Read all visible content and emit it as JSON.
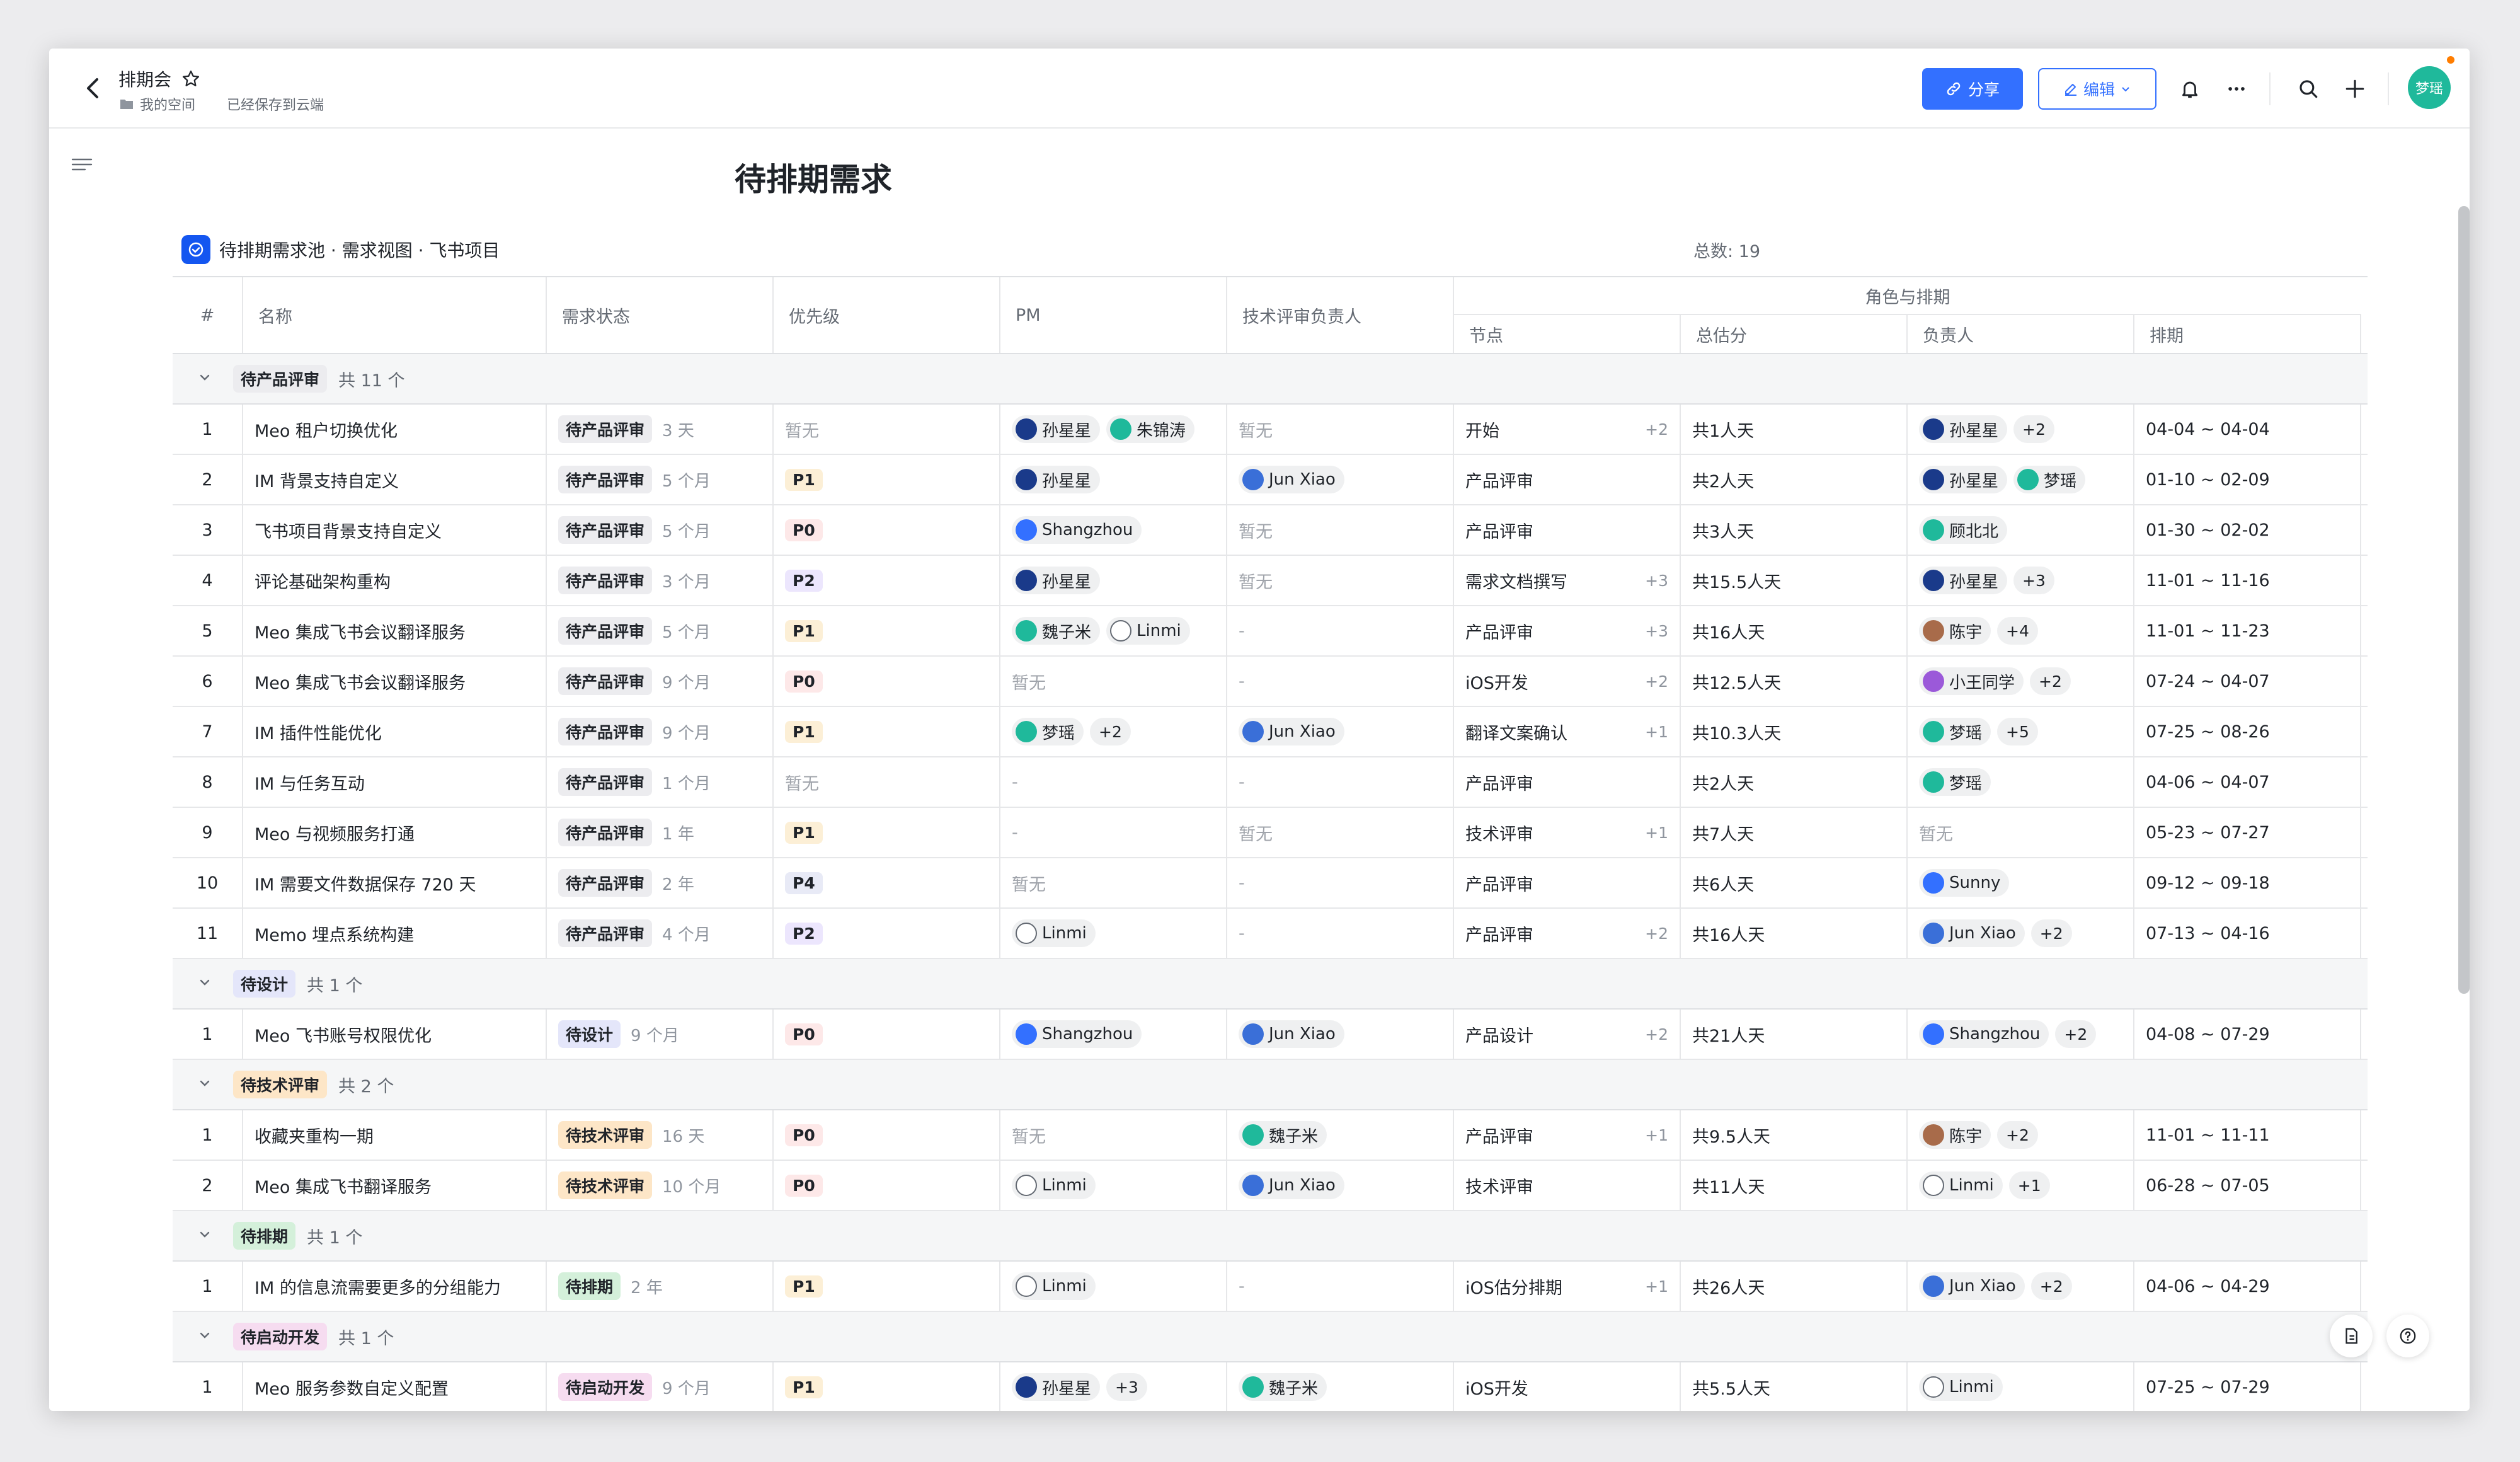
{
  "app": {
    "doc_title": "排期会",
    "crumb_space": "我的空间",
    "saved_status": "已经保存到云端",
    "share_label": "分享",
    "edit_label": "编辑",
    "user_initials": "梦瑶"
  },
  "page_title": "待排期需求",
  "source": {
    "label": "待排期需求池 · 需求视图 · 飞书项目",
    "total": "总数: 19"
  },
  "headers": {
    "num": "#",
    "name": "名称",
    "status": "需求状态",
    "priority": "优先级",
    "pm": "PM",
    "tech": "技术评审负责人",
    "group": "角色与排期",
    "node": "节点",
    "estimate": "总估分",
    "owner": "负责人",
    "schedule": "排期"
  },
  "colors": {
    "accent": "#3370ff",
    "avatar_teal": "#1fb99b",
    "notify": "#ff7d00"
  },
  "groups": [
    {
      "tag": "待产品评审",
      "count": "共 11 个",
      "style": "t-prod",
      "rows": [
        {
          "n": "1",
          "name": "Meo 租户切换优化",
          "status": "待产品评审",
          "age": "3 天",
          "pri": "暂无",
          "pm": [
            {
              "name": "孙星星",
              "c": "#1a3a8a"
            },
            {
              "name": "朱锦涛",
              "c": "#1fb99b"
            }
          ],
          "pm_more": "",
          "tech": [],
          "tech_text": "暂无",
          "node": "开始",
          "node_more": "+2",
          "est": "共1人天",
          "owner": [
            {
              "name": "孙星星",
              "c": "#1a3a8a"
            }
          ],
          "owner_more": "+2",
          "sched": "04-04 ~ 04-04"
        },
        {
          "n": "2",
          "name": "IM 背景支持自定义",
          "status": "待产品评审",
          "age": "5 个月",
          "pri": "P1",
          "pm": [
            {
              "name": "孙星星",
              "c": "#1a3a8a"
            }
          ],
          "pm_more": "",
          "tech": [
            {
              "name": "Jun Xiao",
              "c": "#3a6fd8"
            }
          ],
          "tech_text": "",
          "node": "产品评审",
          "node_more": "",
          "est": "共2人天",
          "owner": [
            {
              "name": "孙星星",
              "c": "#1a3a8a"
            },
            {
              "name": "梦瑶",
              "c": "#1fb99b"
            }
          ],
          "owner_more": "",
          "sched": "01-10 ~ 02-09"
        },
        {
          "n": "3",
          "name": "飞书项目背景支持自定义",
          "status": "待产品评审",
          "age": "5 个月",
          "pri": "P0",
          "pm": [
            {
              "name": "Shangzhou",
              "c": "#3370ff"
            }
          ],
          "pm_more": "",
          "tech": [],
          "tech_text": "暂无",
          "node": "产品评审",
          "node_more": "",
          "est": "共3人天",
          "owner": [
            {
              "name": "顾北北",
              "c": "#1fb99b"
            }
          ],
          "owner_more": "",
          "sched": "01-30 ~ 02-02"
        },
        {
          "n": "4",
          "name": "评论基础架构重构",
          "status": "待产品评审",
          "age": "3 个月",
          "pri": "P2",
          "pm": [
            {
              "name": "孙星星",
              "c": "#1a3a8a"
            }
          ],
          "pm_more": "",
          "tech": [],
          "tech_text": "暂无",
          "node": "需求文档撰写",
          "node_more": "+3",
          "est": "共15.5人天",
          "owner": [
            {
              "name": "孙星星",
              "c": "#1a3a8a"
            }
          ],
          "owner_more": "+3",
          "sched": "11-01 ~ 11-16"
        },
        {
          "n": "5",
          "name": "Meo 集成飞书会议翻译服务",
          "status": "待产品评审",
          "age": "5 个月",
          "pri": "P1",
          "pm": [
            {
              "name": "魏子米",
              "c": "#1fb99b"
            },
            {
              "name": "Linmi",
              "c": "#ffffff"
            }
          ],
          "pm_more": "",
          "tech": [],
          "tech_text": "-",
          "node": "产品评审",
          "node_more": "+3",
          "est": "共16人天",
          "owner": [
            {
              "name": "陈宇",
              "c": "#a86b4a"
            }
          ],
          "owner_more": "+4",
          "sched": "11-01 ~ 11-23"
        },
        {
          "n": "6",
          "name": "Meo 集成飞书会议翻译服务",
          "status": "待产品评审",
          "age": "9 个月",
          "pri": "P0",
          "pm": [],
          "pm_text": "暂无",
          "pm_more": "",
          "tech": [],
          "tech_text": "-",
          "node": "iOS开发",
          "node_more": "+2",
          "est": "共12.5人天",
          "owner": [
            {
              "name": "小王同学",
              "c": "#9b59d9"
            }
          ],
          "owner_more": "+2",
          "sched": "07-24 ~ 04-07"
        },
        {
          "n": "7",
          "name": "IM 插件性能优化",
          "status": "待产品评审",
          "age": "9 个月",
          "pri": "P1",
          "pm": [
            {
              "name": "梦瑶",
              "c": "#1fb99b"
            }
          ],
          "pm_more": "+2",
          "tech": [
            {
              "name": "Jun Xiao",
              "c": "#3a6fd8"
            }
          ],
          "tech_text": "",
          "node": "翻译文案确认",
          "node_more": "+1",
          "est": "共10.3人天",
          "owner": [
            {
              "name": "梦瑶",
              "c": "#1fb99b"
            }
          ],
          "owner_more": "+5",
          "sched": "07-25 ~ 08-26"
        },
        {
          "n": "8",
          "name": "IM 与任务互动",
          "status": "待产品评审",
          "age": "1 个月",
          "pri": "暂无",
          "pm": [],
          "pm_text": "-",
          "pm_more": "",
          "tech": [],
          "tech_text": "-",
          "node": "产品评审",
          "node_more": "",
          "est": "共2人天",
          "owner": [
            {
              "name": "梦瑶",
              "c": "#1fb99b"
            }
          ],
          "owner_more": "",
          "sched": "04-06 ~ 04-07"
        },
        {
          "n": "9",
          "name": "Meo 与视频服务打通",
          "status": "待产品评审",
          "age": "1 年",
          "pri": "P1",
          "pm": [],
          "pm_text": "-",
          "pm_more": "",
          "tech": [],
          "tech_text": "暂无",
          "node": "技术评审",
          "node_more": "+1",
          "est": "共7人天",
          "owner": [],
          "owner_text": "暂无",
          "owner_more": "",
          "sched": "05-23 ~ 07-27"
        },
        {
          "n": "10",
          "name": "IM 需要文件数据保存 720 天",
          "status": "待产品评审",
          "age": "2 年",
          "pri": "P4",
          "pm": [],
          "pm_text": "暂无",
          "pm_more": "",
          "tech": [],
          "tech_text": "-",
          "node": "产品评审",
          "node_more": "",
          "est": "共6人天",
          "owner": [
            {
              "name": "Sunny",
              "c": "#3370ff"
            }
          ],
          "owner_more": "",
          "sched": "09-12 ~ 09-18"
        },
        {
          "n": "11",
          "name": "Memo 埋点系统构建",
          "status": "待产品评审",
          "age": "4 个月",
          "pri": "P2",
          "pm": [
            {
              "name": "Linmi",
              "c": "#ffffff"
            }
          ],
          "pm_more": "",
          "tech": [],
          "tech_text": "-",
          "node": "产品评审",
          "node_more": "+2",
          "est": "共16人天",
          "owner": [
            {
              "name": "Jun Xiao",
              "c": "#3a6fd8"
            }
          ],
          "owner_more": "+2",
          "sched": "07-13 ~ 04-16"
        }
      ]
    },
    {
      "tag": "待设计",
      "count": "共 1 个",
      "style": "t-design",
      "rows": [
        {
          "n": "1",
          "name": "Meo 飞书账号权限优化",
          "status": "待设计",
          "age": "9 个月",
          "pri": "P0",
          "pm": [
            {
              "name": "Shangzhou",
              "c": "#3370ff"
            }
          ],
          "pm_more": "",
          "tech": [
            {
              "name": "Jun Xiao",
              "c": "#3a6fd8"
            }
          ],
          "tech_text": "",
          "node": "产品设计",
          "node_more": "+2",
          "est": "共21人天",
          "owner": [
            {
              "name": "Shangzhou",
              "c": "#3370ff"
            }
          ],
          "owner_more": "+2",
          "sched": "04-08 ~ 07-29"
        }
      ]
    },
    {
      "tag": "待技术评审",
      "count": "共 2 个",
      "style": "t-tech",
      "rows": [
        {
          "n": "1",
          "name": "收藏夹重构一期",
          "status": "待技术评审",
          "age": "16 天",
          "pri": "P0",
          "pm": [],
          "pm_text": "暂无",
          "pm_more": "",
          "tech": [
            {
              "name": "魏子米",
              "c": "#1fb99b"
            }
          ],
          "tech_text": "",
          "node": "产品评审",
          "node_more": "+1",
          "est": "共9.5人天",
          "owner": [
            {
              "name": "陈宇",
              "c": "#a86b4a"
            }
          ],
          "owner_more": "+2",
          "sched": "11-01 ~ 11-11"
        },
        {
          "n": "2",
          "name": "Meo 集成飞书翻译服务",
          "status": "待技术评审",
          "age": "10 个月",
          "pri": "P0",
          "pm": [
            {
              "name": "Linmi",
              "c": "#ffffff"
            }
          ],
          "pm_more": "",
          "tech": [
            {
              "name": "Jun Xiao",
              "c": "#3a6fd8"
            }
          ],
          "tech_text": "",
          "node": "技术评审",
          "node_more": "",
          "est": "共11人天",
          "owner": [
            {
              "name": "Linmi",
              "c": "#ffffff"
            }
          ],
          "owner_more": "+1",
          "sched": "06-28 ~ 07-05"
        }
      ]
    },
    {
      "tag": "待排期",
      "count": "共 1 个",
      "style": "t-sched",
      "rows": [
        {
          "n": "1",
          "name": "IM 的信息流需要更多的分组能力",
          "status": "待排期",
          "age": "2 年",
          "pri": "P1",
          "pm": [
            {
              "name": "Linmi",
              "c": "#ffffff"
            }
          ],
          "pm_more": "",
          "tech": [],
          "tech_text": "-",
          "node": "iOS估分排期",
          "node_more": "+1",
          "est": "共26人天",
          "owner": [
            {
              "name": "Jun Xiao",
              "c": "#3a6fd8"
            }
          ],
          "owner_more": "+2",
          "sched": "04-06 ~ 04-29"
        }
      ]
    },
    {
      "tag": "待启动开发",
      "count": "共 1 个",
      "style": "t-dev",
      "rows": [
        {
          "n": "1",
          "name": "Meo 服务参数自定义配置",
          "status": "待启动开发",
          "age": "9 个月",
          "pri": "P1",
          "pm": [
            {
              "name": "孙星星",
              "c": "#1a3a8a"
            }
          ],
          "pm_more": "+3",
          "tech": [
            {
              "name": "魏子米",
              "c": "#1fb99b"
            }
          ],
          "tech_text": "",
          "node": "iOS开发",
          "node_more": "",
          "est": "共5.5人天",
          "owner": [
            {
              "name": "Linmi",
              "c": "#ffffff"
            }
          ],
          "owner_more": "",
          "sched": "07-25 ~ 07-29"
        }
      ]
    }
  ]
}
